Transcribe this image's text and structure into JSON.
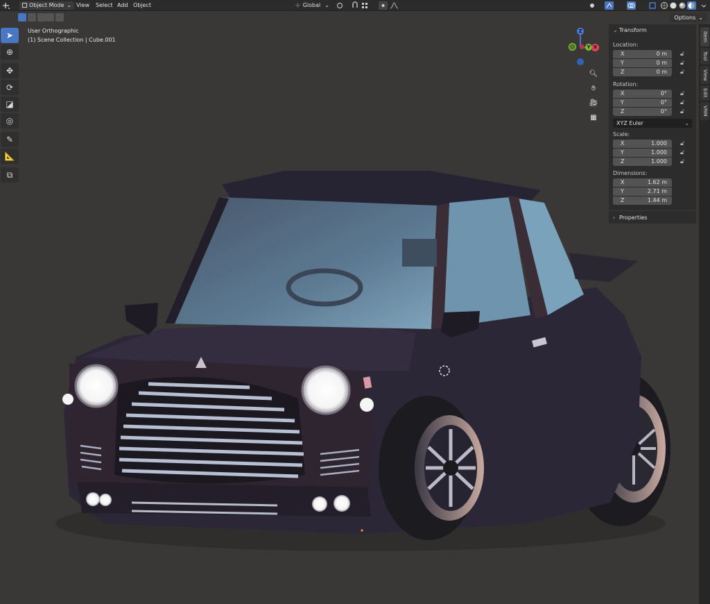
{
  "header": {
    "mode": "Object Mode",
    "menus": [
      "View",
      "Select",
      "Add",
      "Object"
    ],
    "orientation": "Global",
    "options_label": "Options"
  },
  "viewport": {
    "view_name": "User Orthographic",
    "collection": "(1) Scene Collection | Cube.001",
    "gizmo_axes": [
      "Z",
      "Y",
      "X"
    ]
  },
  "toolbar": {
    "tools": [
      "select-box",
      "cursor",
      "move",
      "rotate",
      "scale",
      "transform",
      "annotate",
      "measure",
      "add-cube"
    ]
  },
  "panel": {
    "section_title": "Transform",
    "location_label": "Location:",
    "location": [
      {
        "axis": "X",
        "value": "0 m"
      },
      {
        "axis": "Y",
        "value": "0 m"
      },
      {
        "axis": "Z",
        "value": "0 m"
      }
    ],
    "rotation_label": "Rotation:",
    "rotation": [
      {
        "axis": "X",
        "value": "0°"
      },
      {
        "axis": "Y",
        "value": "0°"
      },
      {
        "axis": "Z",
        "value": "0°"
      }
    ],
    "rotation_mode": "XYZ Euler",
    "scale_label": "Scale:",
    "scale": [
      {
        "axis": "X",
        "value": "1.000"
      },
      {
        "axis": "Y",
        "value": "1.000"
      },
      {
        "axis": "Z",
        "value": "1.000"
      }
    ],
    "dimensions_label": "Dimensions:",
    "dimensions": [
      {
        "axis": "X",
        "value": "1.62 m"
      },
      {
        "axis": "Y",
        "value": "2.71 m"
      },
      {
        "axis": "Z",
        "value": "1.44 m"
      }
    ],
    "properties_title": "Properties"
  },
  "side_tabs": [
    "Item",
    "Tool",
    "View",
    "Edit",
    "VRM"
  ],
  "colors": {
    "accent": "#4a77c4",
    "background": "#3a3737",
    "car_body": "#2b2736",
    "glass": "#6d8ea6"
  }
}
